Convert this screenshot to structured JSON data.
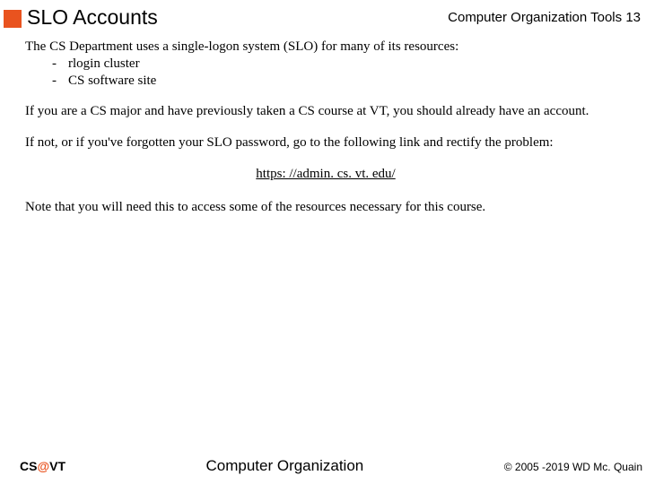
{
  "header": {
    "title": "SLO Accounts",
    "course": "Computer Organization Tools",
    "page": "13"
  },
  "body": {
    "intro": "The CS Department uses a single-logon system (SLO) for many of its resources:",
    "bullets": [
      "rlogin cluster",
      "CS software site"
    ],
    "p2": "If you are a CS major and have previously taken a CS course at VT, you should already have an account.",
    "p3": "If not, or if you've forgotten your SLO password, go to the following link and rectify the problem:",
    "link": "https: //admin. cs. vt. edu/",
    "p4": "Note that you will need this to access some of the resources necessary for this course."
  },
  "footer": {
    "brand_prefix": "CS",
    "brand_at": "@",
    "brand_suffix": "VT",
    "center": "Computer Organization",
    "copyright": "© 2005 -2019 WD Mc. Quain"
  }
}
